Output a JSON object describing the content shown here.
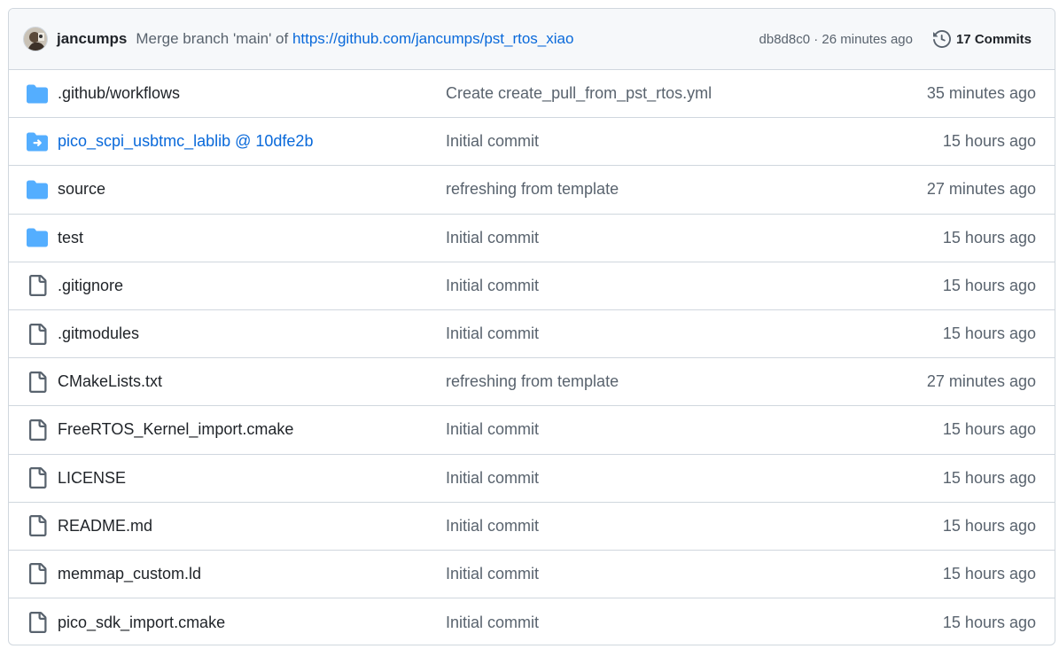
{
  "header": {
    "author": "jancumps",
    "message_prefix": "Merge branch 'main' of",
    "message_link": "https://github.com/jancumps/pst_rtos_xiao",
    "sha": "db8d8c0",
    "separator": "·",
    "time": "26 minutes ago",
    "commits_label": "17 Commits",
    "history_icon": "history-icon"
  },
  "colors": {
    "folder": "#54aeff",
    "link": "#0969da",
    "muted": "#59636e",
    "border": "#d0d7de"
  },
  "files": [
    {
      "name": ".github/workflows",
      "type": "folder",
      "message": "Create create_pull_from_pst_rtos.yml",
      "age": "35 minutes ago"
    },
    {
      "name": "pico_scpi_usbtmc_lablib @ 10dfe2b",
      "type": "submodule",
      "message": "Initial commit",
      "age": "15 hours ago"
    },
    {
      "name": "source",
      "type": "folder",
      "message": "refreshing from template",
      "age": "27 minutes ago"
    },
    {
      "name": "test",
      "type": "folder",
      "message": "Initial commit",
      "age": "15 hours ago"
    },
    {
      "name": ".gitignore",
      "type": "file",
      "message": "Initial commit",
      "age": "15 hours ago"
    },
    {
      "name": ".gitmodules",
      "type": "file",
      "message": "Initial commit",
      "age": "15 hours ago"
    },
    {
      "name": "CMakeLists.txt",
      "type": "file",
      "message": "refreshing from template",
      "age": "27 minutes ago"
    },
    {
      "name": "FreeRTOS_Kernel_import.cmake",
      "type": "file",
      "message": "Initial commit",
      "age": "15 hours ago"
    },
    {
      "name": "LICENSE",
      "type": "file",
      "message": "Initial commit",
      "age": "15 hours ago"
    },
    {
      "name": "README.md",
      "type": "file",
      "message": "Initial commit",
      "age": "15 hours ago"
    },
    {
      "name": "memmap_custom.ld",
      "type": "file",
      "message": "Initial commit",
      "age": "15 hours ago"
    },
    {
      "name": "pico_sdk_import.cmake",
      "type": "file",
      "message": "Initial commit",
      "age": "15 hours ago"
    }
  ]
}
